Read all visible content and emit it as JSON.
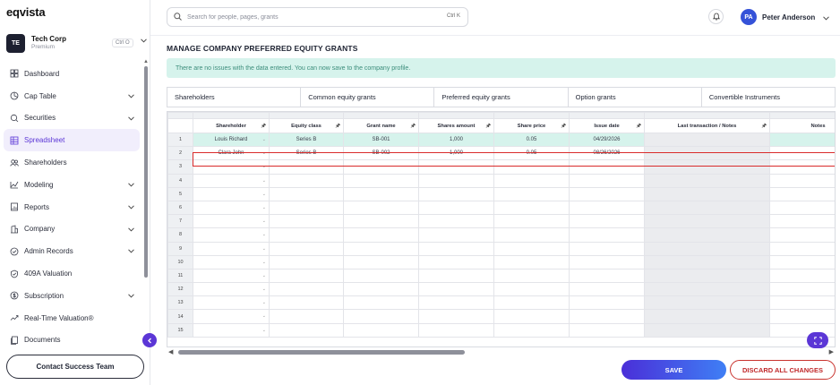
{
  "app": {
    "logo": "eqvista"
  },
  "org": {
    "initials": "TE",
    "name": "Tech Corp",
    "plan": "Premium",
    "shortcut": "Ctrl O"
  },
  "sidebar": {
    "items": [
      {
        "label": "Dashboard",
        "icon": "dashboard-icon",
        "chevron": false,
        "active": false
      },
      {
        "label": "Cap Table",
        "icon": "cap-table-icon",
        "chevron": true,
        "active": false
      },
      {
        "label": "Securities",
        "icon": "securities-icon",
        "chevron": true,
        "active": false
      },
      {
        "label": "Spreadsheet",
        "icon": "spreadsheet-icon",
        "chevron": false,
        "active": true
      },
      {
        "label": "Shareholders",
        "icon": "shareholders-icon",
        "chevron": false,
        "active": false
      },
      {
        "label": "Modeling",
        "icon": "modeling-icon",
        "chevron": true,
        "active": false
      },
      {
        "label": "Reports",
        "icon": "reports-icon",
        "chevron": true,
        "active": false
      },
      {
        "label": "Company",
        "icon": "company-icon",
        "chevron": true,
        "active": false
      },
      {
        "label": "Admin Records",
        "icon": "admin-records-icon",
        "chevron": true,
        "active": false
      },
      {
        "label": "409A Valuation",
        "icon": "valuation-icon",
        "chevron": false,
        "active": false
      },
      {
        "label": "Subscription",
        "icon": "subscription-icon",
        "chevron": true,
        "active": false
      },
      {
        "label": "Real-Time Valuation®",
        "icon": "realtime-valuation-icon",
        "chevron": false,
        "active": false
      },
      {
        "label": "Documents",
        "icon": "documents-icon",
        "chevron": false,
        "active": false
      }
    ],
    "contact_label": "Contact Success Team"
  },
  "header": {
    "search_placeholder": "Search for people, pages, grants",
    "search_shortcut": "Ctrl K",
    "user_initials": "PA",
    "user_name": "Peter Anderson"
  },
  "main": {
    "title": "MANAGE COMPANY PREFERRED EQUITY GRANTS",
    "alert": "There are no issues with the data entered. You can now save to the company profile.",
    "tabs": [
      {
        "label": "Shareholders",
        "active": false
      },
      {
        "label": "Common equity grants",
        "active": false
      },
      {
        "label": "Preferred equity grants",
        "active": true
      },
      {
        "label": "Option grants",
        "active": false
      },
      {
        "label": "Convertible Instruments",
        "active": false
      }
    ],
    "grid": {
      "columns": [
        "Shareholder",
        "Equity class",
        "Grant name",
        "Shares amount",
        "Share price",
        "Issue date",
        "Last transaction / Notes",
        "Notes"
      ],
      "rows": [
        {
          "num": "1",
          "cells": [
            "Louis Richard",
            "Series B",
            "SB-001",
            "1,000",
            "0.05",
            "04/29/2026",
            "",
            ""
          ]
        },
        {
          "num": "2",
          "cells": [
            "Clara John",
            "Series B",
            "SB-002",
            "1,000",
            "0.05",
            "08/26/2026",
            "",
            ""
          ]
        },
        {
          "num": "3",
          "cells": [
            "",
            "",
            "",
            "",
            "",
            "",
            "",
            ""
          ]
        },
        {
          "num": "4",
          "cells": [
            "",
            "",
            "",
            "",
            "",
            "",
            "",
            ""
          ]
        },
        {
          "num": "5",
          "cells": [
            "",
            "",
            "",
            "",
            "",
            "",
            "",
            ""
          ]
        },
        {
          "num": "6",
          "cells": [
            "",
            "",
            "",
            "",
            "",
            "",
            "",
            ""
          ]
        },
        {
          "num": "7",
          "cells": [
            "",
            "",
            "",
            "",
            "",
            "",
            "",
            ""
          ]
        },
        {
          "num": "8",
          "cells": [
            "",
            "",
            "",
            "",
            "",
            "",
            "",
            ""
          ]
        },
        {
          "num": "9",
          "cells": [
            "",
            "",
            "",
            "",
            "",
            "",
            "",
            ""
          ]
        },
        {
          "num": "10",
          "cells": [
            "",
            "",
            "",
            "",
            "",
            "",
            "",
            ""
          ]
        },
        {
          "num": "11",
          "cells": [
            "",
            "",
            "",
            "",
            "",
            "",
            "",
            ""
          ]
        },
        {
          "num": "12",
          "cells": [
            "",
            "",
            "",
            "",
            "",
            "",
            "",
            ""
          ]
        },
        {
          "num": "13",
          "cells": [
            "",
            "",
            "",
            "",
            "",
            "",
            "",
            ""
          ]
        },
        {
          "num": "14",
          "cells": [
            "",
            "",
            "",
            "",
            "",
            "",
            "",
            ""
          ]
        },
        {
          "num": "15",
          "cells": [
            "",
            "",
            "",
            "",
            "",
            "",
            "",
            ""
          ]
        }
      ],
      "selected_row": "2"
    },
    "save_label": "SAVE",
    "discard_label": "DISCARD ALL CHANGES"
  },
  "colors": {
    "accent": "#5b36d6",
    "alert_bg": "#d6f3ec",
    "alert_text": "#3d8e7c",
    "selection": "#d92b2b",
    "discard": "#c0282a"
  }
}
